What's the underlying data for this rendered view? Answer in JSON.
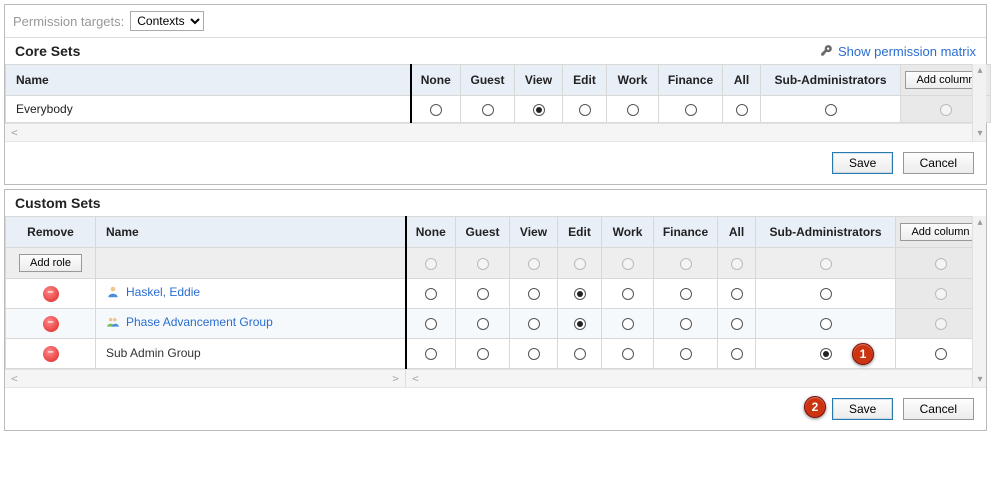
{
  "permission_targets": {
    "label": "Permission targets:",
    "selected": "Contexts"
  },
  "matrix_link": "Show permission matrix",
  "columns": {
    "none": "None",
    "guest": "Guest",
    "view": "View",
    "edit": "Edit",
    "work": "Work",
    "finance": "Finance",
    "all": "All",
    "sub": "Sub-Administrators",
    "add": "Add column"
  },
  "name_header": "Name",
  "remove_header": "Remove",
  "add_role_label": "Add role",
  "buttons": {
    "save": "Save",
    "cancel": "Cancel"
  },
  "core": {
    "title": "Core Sets",
    "rows": [
      {
        "name": "Everybody",
        "selected": "view",
        "last_disabled": true
      }
    ]
  },
  "custom": {
    "title": "Custom Sets",
    "rows": [
      {
        "name": "Haskel, Eddie",
        "icon": "user-icon",
        "link": true,
        "selected": "edit",
        "last_disabled": true,
        "removable": true
      },
      {
        "name": "Phase Advancement Group",
        "icon": "group-icon",
        "link": true,
        "selected": "edit",
        "last_disabled": true,
        "removable": true
      },
      {
        "name": "Sub Admin Group",
        "icon": null,
        "link": false,
        "selected": "sub",
        "last_disabled": false,
        "removable": true,
        "callout": "1"
      }
    ]
  },
  "callout2": "2"
}
